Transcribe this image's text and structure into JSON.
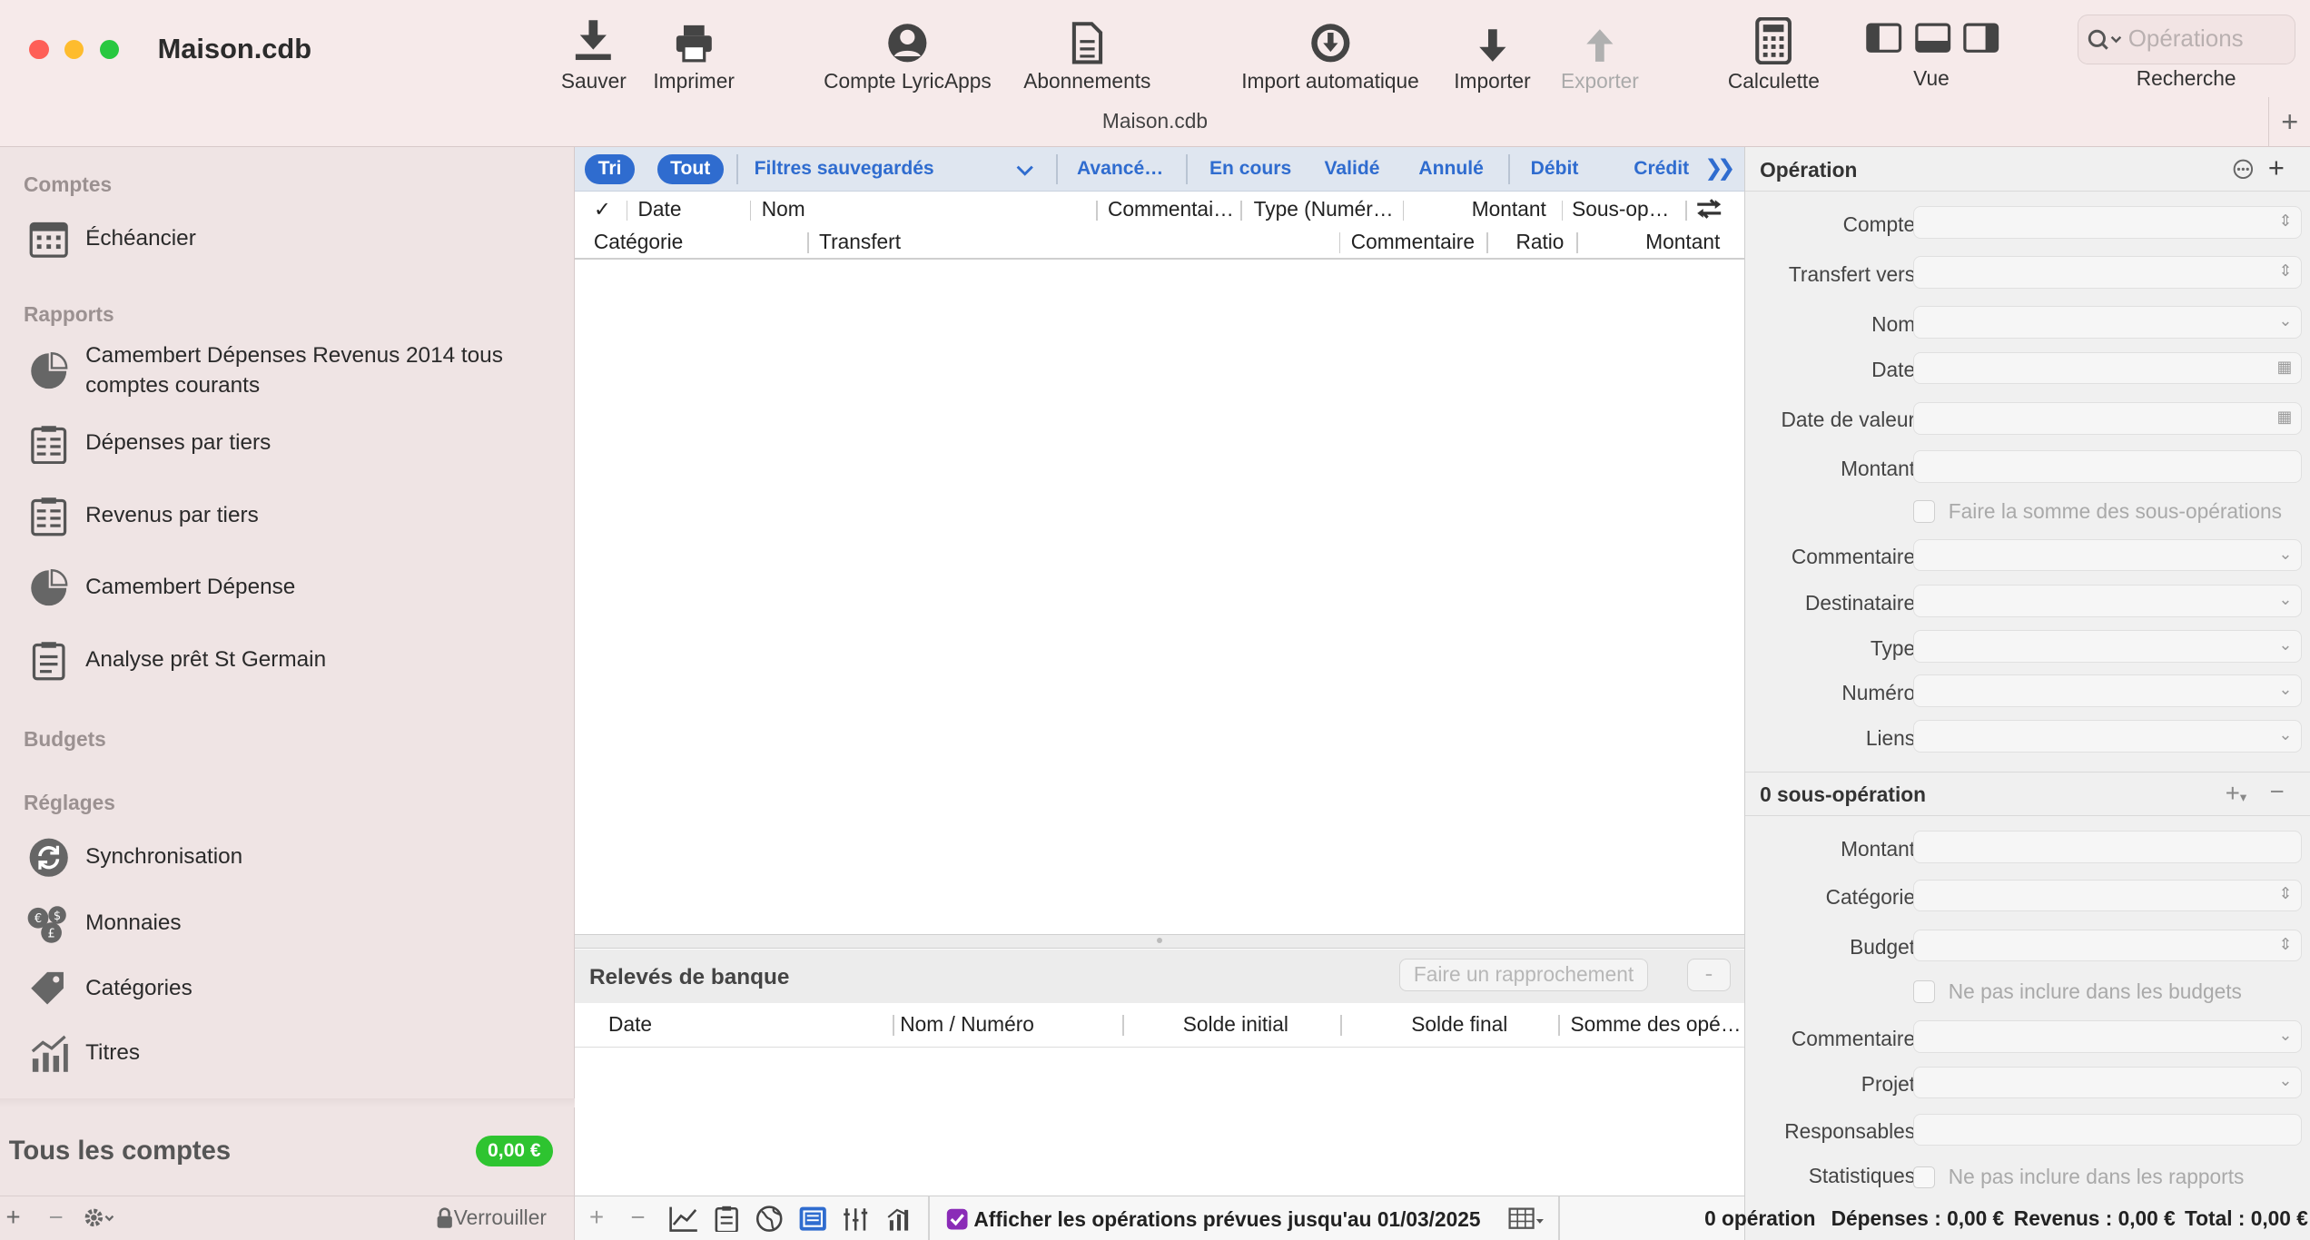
{
  "window": {
    "title": "Maison.cdb",
    "subtitle": "Maison.cdb",
    "traffic_colors": [
      "#fe5f57",
      "#febc2e",
      "#28c840"
    ]
  },
  "toolbar": {
    "save": "Sauver",
    "print": "Imprimer",
    "lyricapps_account": "Compte LyricApps",
    "subscriptions": "Abonnements",
    "auto_import": "Import automatique",
    "import": "Importer",
    "export": "Exporter",
    "calculator": "Calculette",
    "view": "Vue",
    "search_placeholder": "Opérations",
    "search_label": "Recherche",
    "add_tab": "+"
  },
  "sidebar": {
    "section_accounts": "Comptes",
    "schedule": "Échéancier",
    "section_reports": "Rapports",
    "reports": [
      "Camembert Dépenses Revenus 2014 tous comptes courants",
      "Dépenses par tiers",
      "Revenus par tiers",
      "Camembert Dépense",
      "Analyse prêt St Germain"
    ],
    "section_budgets": "Budgets",
    "section_settings": "Réglages",
    "settings": [
      "Synchronisation",
      "Monnaies",
      "Catégories",
      "Titres"
    ],
    "all_accounts_label": "Tous les comptes",
    "all_accounts_balance": "0,00 €",
    "lock_label": "Verrouiller",
    "add": "+",
    "remove": "−"
  },
  "filters": {
    "sort": "Tri",
    "all": "Tout",
    "saved": "Filtres sauvegardés",
    "advanced": "Avancé…",
    "pending": "En cours",
    "validated": "Validé",
    "cancelled": "Annulé",
    "debit": "Débit",
    "credit": "Crédit",
    "more": "❯❯"
  },
  "columns": {
    "row1": {
      "check": "✓",
      "date": "Date",
      "name": "Nom",
      "comment": "Commentai…",
      "type": "Type (Numér…",
      "amount": "Montant",
      "sub": "Sous-op…"
    },
    "row2": {
      "category": "Catégorie",
      "transfer": "Transfert",
      "comment": "Commentaire",
      "ratio": "Ratio",
      "amount": "Montant"
    }
  },
  "bank": {
    "title": "Relevés de banque",
    "reconcile": "Faire un rapprochement",
    "remove": "-",
    "columns": {
      "date": "Date",
      "name_number": "Nom / Numéro",
      "initial": "Solde initial",
      "final": "Solde final",
      "sum": "Somme des opé…"
    }
  },
  "bottom": {
    "show_planned": "Afficher les opérations prévues jusqu'au 01/03/2025"
  },
  "operation": {
    "title": "Opération",
    "labels": {
      "account": "Compte",
      "transfer_to": "Transfert vers",
      "name": "Nom",
      "date": "Date",
      "value_date": "Date de valeur",
      "amount": "Montant",
      "sum_sub": "Faire la somme des sous-opérations",
      "comment": "Commentaire",
      "recipient": "Destinataire",
      "type": "Type",
      "number": "Numéro",
      "links": "Liens"
    }
  },
  "sub_operation": {
    "title": "0 sous-opération",
    "labels": {
      "amount": "Montant",
      "category": "Catégorie",
      "budget": "Budget",
      "exclude_budgets": "Ne pas inclure dans les budgets",
      "comment": "Commentaire",
      "project": "Projet",
      "responsible": "Responsables",
      "stats": "Statistiques",
      "exclude_reports": "Ne pas inclure dans les rapports"
    }
  },
  "status": {
    "count": "0 opération",
    "expenses": "Dépenses : 0,00 €",
    "income": "Revenus : 0,00 €",
    "total": "Total : 0,00 €"
  }
}
